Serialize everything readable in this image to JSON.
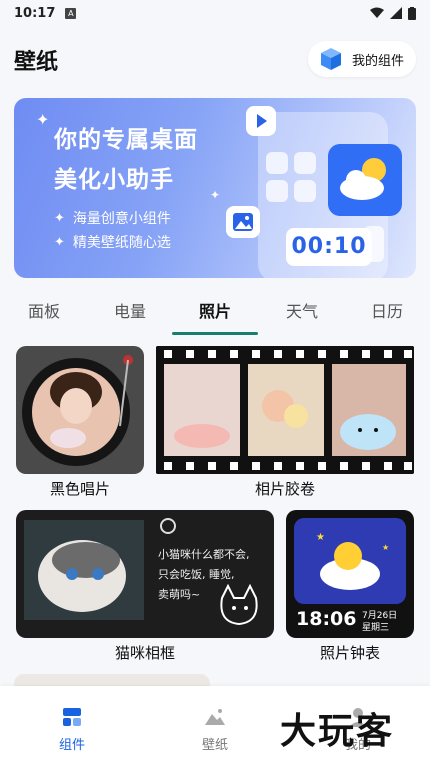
{
  "status": {
    "time": "10:17",
    "sim": "A"
  },
  "header": {
    "title": "壁纸",
    "my_widgets": "我的组件"
  },
  "banner": {
    "line1": "你的专属桌面",
    "line2": "美化小助手",
    "bullet1": "海量创意小组件",
    "bullet2": "精美壁纸随心选",
    "timer": "00:10"
  },
  "tabs": [
    "面板",
    "电量",
    "照片",
    "天气",
    "日历"
  ],
  "active_tab": "照片",
  "cards": {
    "record": "黑色唱片",
    "film": "相片胶卷",
    "cat": "猫咪相框",
    "clock": "照片钟表"
  },
  "cat_note": {
    "l1": "小猫咪什么都不会,",
    "l2": "只会吃饭, 睡觉,",
    "l3": "卖萌吗~"
  },
  "clock": {
    "time": "18:06",
    "date": "7月26日",
    "weekday": "星期三"
  },
  "nav": {
    "widgets": "组件",
    "wallpaper": "壁纸",
    "mine": "我的"
  },
  "watermark": "大玩客",
  "colors": {
    "accent": "#1a63e0",
    "tab_indicator": "#1a7f6a",
    "banner": "#7d98f5"
  }
}
